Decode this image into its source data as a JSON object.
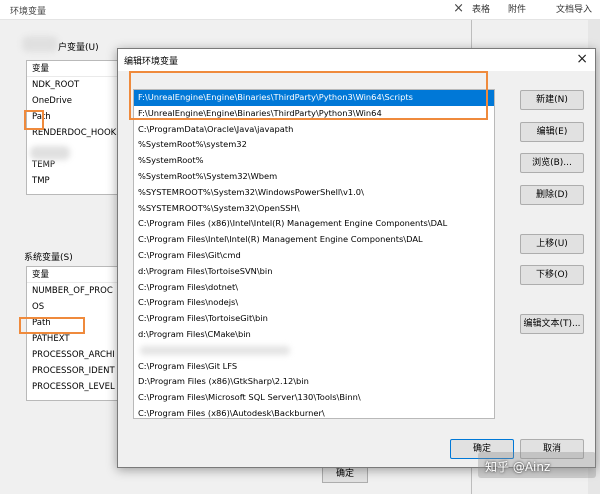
{
  "bg_window": {
    "title": "环境变量",
    "close": "×",
    "user_group_label": "户变量(U)",
    "user_vars": {
      "header": "变量",
      "items": [
        "NDK_ROOT",
        "OneDrive",
        "Path",
        "RENDERDOC_HOOK",
        "",
        "TEMP",
        "TMP"
      ]
    },
    "sys_group_label": "系统变量(S)",
    "sys_vars": {
      "header": "变量",
      "items": [
        "NUMBER_OF_PROC",
        "OS",
        "Path",
        "PATHEXT",
        "PROCESSOR_ARCHI",
        "PROCESSOR_IDENT",
        "PROCESSOR_LEVEL"
      ]
    },
    "ok_label": "确定"
  },
  "host": {
    "tab1": "表格",
    "tab2": "附件",
    "tab3": "文档导入"
  },
  "dialog": {
    "title": "编辑环境变量",
    "close": "×",
    "paths": [
      "F:\\UnrealEngine\\Engine\\Binaries\\ThirdParty\\Python3\\Win64\\Scripts",
      "F:\\UnrealEngine\\Engine\\Binaries\\ThirdParty\\Python3\\Win64",
      "C:\\ProgramData\\Oracle\\Java\\javapath",
      "%SystemRoot%\\system32",
      "%SystemRoot%",
      "%SystemRoot%\\System32\\Wbem",
      "%SYSTEMROOT%\\System32\\WindowsPowerShell\\v1.0\\",
      "%SYSTEMROOT%\\System32\\OpenSSH\\",
      "C:\\Program Files (x86)\\Intel\\Intel(R) Management Engine Components\\DAL",
      "C:\\Program Files\\Intel\\Intel(R) Management Engine Components\\DAL",
      "C:\\Program Files\\Git\\cmd",
      "d:\\Program Files\\TortoiseSVN\\bin",
      "C:\\Program Files\\dotnet\\",
      "C:\\Program Files\\nodejs\\",
      "C:\\Program Files\\TortoiseGit\\bin",
      "d:\\Program Files\\CMake\\bin",
      "",
      "C:\\Program Files\\Git LFS",
      "D:\\Program Files (x86)\\GtkSharp\\2.12\\bin",
      "C:\\Program Files\\Microsoft SQL Server\\130\\Tools\\Binn\\",
      "C:\\Program Files (x86)\\Autodesk\\Backburner\\"
    ],
    "buttons": {
      "new": "新建(N)",
      "edit": "编辑(E)",
      "browse": "浏览(B)...",
      "delete": "删除(D)",
      "move_up": "上移(U)",
      "move_down": "下移(O)",
      "edit_text": "编辑文本(T)...",
      "ok": "确定",
      "cancel": "取消"
    }
  },
  "watermark": "知乎 @Ainz"
}
